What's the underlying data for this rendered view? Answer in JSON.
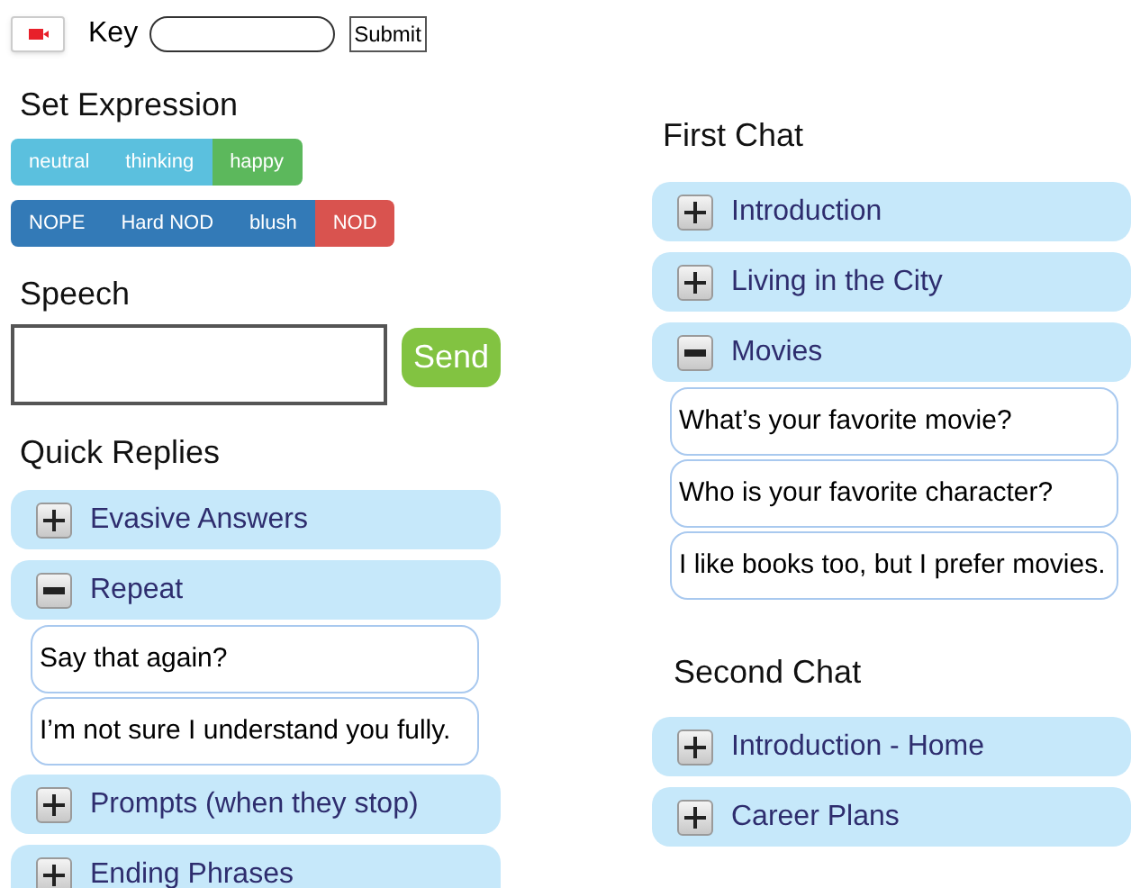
{
  "key_row": {
    "label": "Key",
    "submit": "Submit"
  },
  "expression": {
    "title": "Set Expression",
    "rows": [
      [
        {
          "label": "neutral",
          "color": "#5bc0de"
        },
        {
          "label": "thinking",
          "color": "#5bc0de"
        },
        {
          "label": "happy",
          "color": "#5cb85c"
        }
      ],
      [
        {
          "label": "NOPE",
          "color": "#337ab7"
        },
        {
          "label": "Hard NOD",
          "color": "#337ab7"
        },
        {
          "label": "blush",
          "color": "#337ab7"
        },
        {
          "label": "NOD",
          "color": "#d9534f"
        }
      ]
    ]
  },
  "speech": {
    "title": "Speech",
    "send": "Send"
  },
  "quick_replies": {
    "title": "Quick Replies",
    "groups": [
      {
        "label": "Evasive Answers",
        "expanded": false
      },
      {
        "label": "Repeat",
        "expanded": true,
        "children": [
          "Say that again?",
          "I’m not sure I understand you fully."
        ]
      },
      {
        "label": "Prompts (when they stop)",
        "expanded": false
      },
      {
        "label": "Ending Phrases",
        "expanded": false
      }
    ]
  },
  "first_chat": {
    "title": "First Chat",
    "groups": [
      {
        "label": "Introduction",
        "expanded": false
      },
      {
        "label": "Living in the City",
        "expanded": false
      },
      {
        "label": "Movies",
        "expanded": true,
        "children": [
          "What’s your favorite movie?",
          "Who is your favorite character?",
          "I like books too, but I prefer movies."
        ]
      }
    ]
  },
  "second_chat": {
    "title": "Second Chat",
    "groups": [
      {
        "label": "Introduction - Home",
        "expanded": false
      },
      {
        "label": "Career Plans",
        "expanded": false
      }
    ]
  }
}
